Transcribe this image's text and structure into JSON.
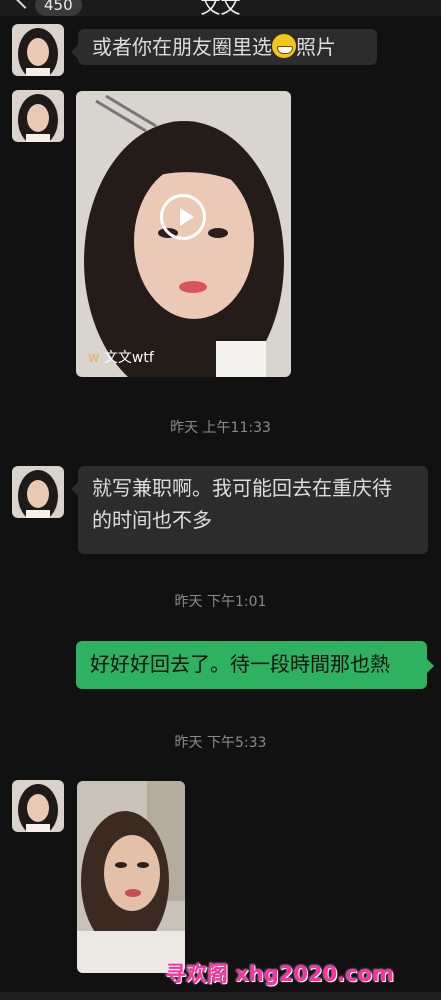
{
  "header": {
    "back_icon": "chevron-left-icon",
    "unread_count": "450",
    "title": "文文"
  },
  "messages": [
    {
      "type": "text",
      "side": "left",
      "text_before_emoji": "或者你在朋友圈里选",
      "emoji": "grin-emoji",
      "text_after_emoji": "照片"
    },
    {
      "type": "video",
      "side": "left",
      "author": "文文wtf"
    },
    {
      "type": "timestamp",
      "text": "昨天 上午11:33"
    },
    {
      "type": "text",
      "side": "left",
      "line1": "就写兼职啊。我可能回去在重庆待",
      "line2": "的时间也不多"
    },
    {
      "type": "timestamp",
      "text": "昨天 下午1:01"
    },
    {
      "type": "text",
      "side": "right",
      "text": "好好好回去了。待一段時間那也熱"
    },
    {
      "type": "timestamp",
      "text": "昨天 下午5:33"
    },
    {
      "type": "image",
      "side": "left"
    }
  ],
  "watermark": "寻欢阁 xhg2020.com",
  "colors": {
    "background": "#111111",
    "bubble_incoming": "#2c2c2c",
    "bubble_outgoing": "#2fb25f",
    "watermark": "#ff2fa3"
  }
}
